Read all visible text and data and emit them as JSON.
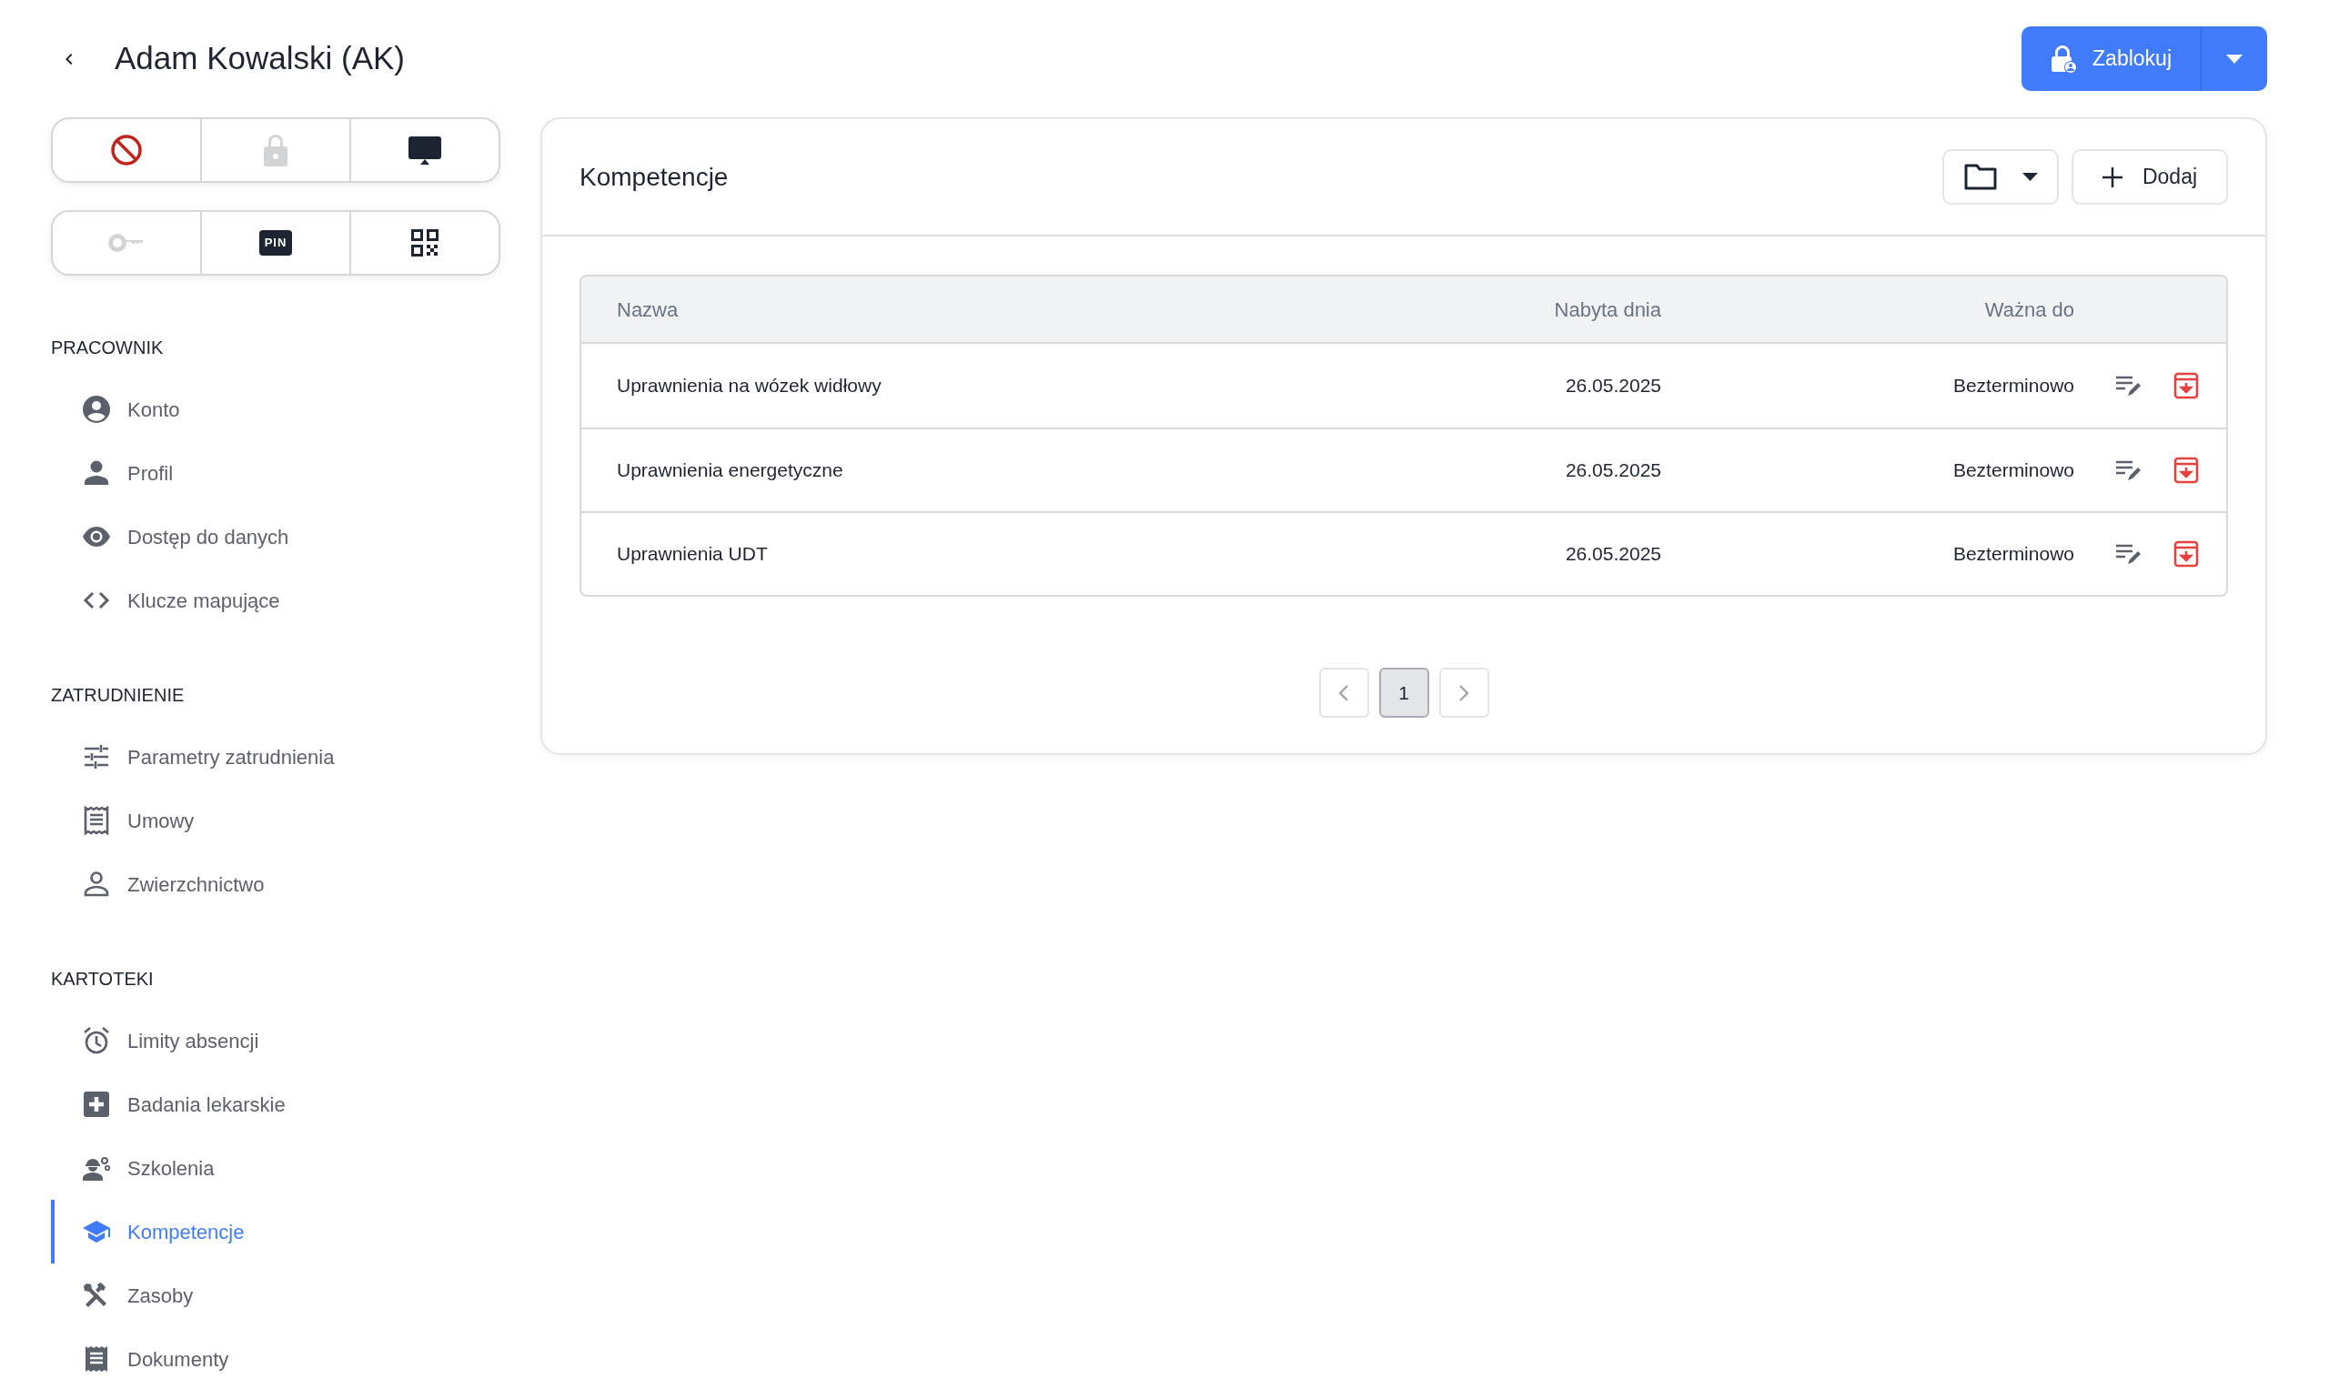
{
  "header": {
    "title": "Adam Kowalski (AK)",
    "primary_action": "Zablokuj"
  },
  "quick_actions": [
    [
      {
        "kind": "block",
        "disabled": false
      },
      {
        "kind": "lock",
        "disabled": true
      },
      {
        "kind": "monitor",
        "disabled": false
      }
    ],
    [
      {
        "kind": "key",
        "disabled": true
      },
      {
        "kind": "pin",
        "disabled": false,
        "label": "PIN"
      },
      {
        "kind": "qr",
        "disabled": false
      }
    ]
  ],
  "sidebar": [
    {
      "heading": "PRACOWNIK",
      "items": [
        {
          "kind": "account",
          "label": "Konto",
          "selected": false
        },
        {
          "kind": "person",
          "label": "Profil",
          "selected": false
        },
        {
          "kind": "eye",
          "label": "Dostęp do danych",
          "selected": false
        },
        {
          "kind": "code",
          "label": "Klucze mapujące",
          "selected": false
        }
      ]
    },
    {
      "heading": "ZATRUDNIENIE",
      "items": [
        {
          "kind": "sliders",
          "label": "Parametry zatrudnienia",
          "selected": false
        },
        {
          "kind": "receipt",
          "label": "Umowy",
          "selected": false
        },
        {
          "kind": "person-outline",
          "label": "Zwierzchnictwo",
          "selected": false
        }
      ]
    },
    {
      "heading": "KARTOTEKI",
      "items": [
        {
          "kind": "alarm",
          "label": "Limity absencji",
          "selected": false
        },
        {
          "kind": "medical",
          "label": "Badania lekarskie",
          "selected": false
        },
        {
          "kind": "worker",
          "label": "Szkolenia",
          "selected": false
        },
        {
          "kind": "school",
          "label": "Kompetencje",
          "selected": true
        },
        {
          "kind": "tools",
          "label": "Zasoby",
          "selected": false
        },
        {
          "kind": "receipt-filled",
          "label": "Dokumenty",
          "selected": false
        }
      ]
    }
  ],
  "card": {
    "title": "Kompetencje",
    "add_button": "Dodaj",
    "table": {
      "columns": [
        "Nazwa",
        "Nabyta dnia",
        "Ważna do"
      ],
      "rows": [
        [
          "Uprawnienia na wózek widłowy",
          "26.05.2025",
          "Bezterminowo"
        ],
        [
          "Uprawnienia energetyczne",
          "26.05.2025",
          "Bezterminowo"
        ],
        [
          "Uprawnienia UDT",
          "26.05.2025",
          "Bezterminowo"
        ]
      ]
    },
    "pagination": [
      {
        "label": "1",
        "selected": true
      }
    ]
  }
}
